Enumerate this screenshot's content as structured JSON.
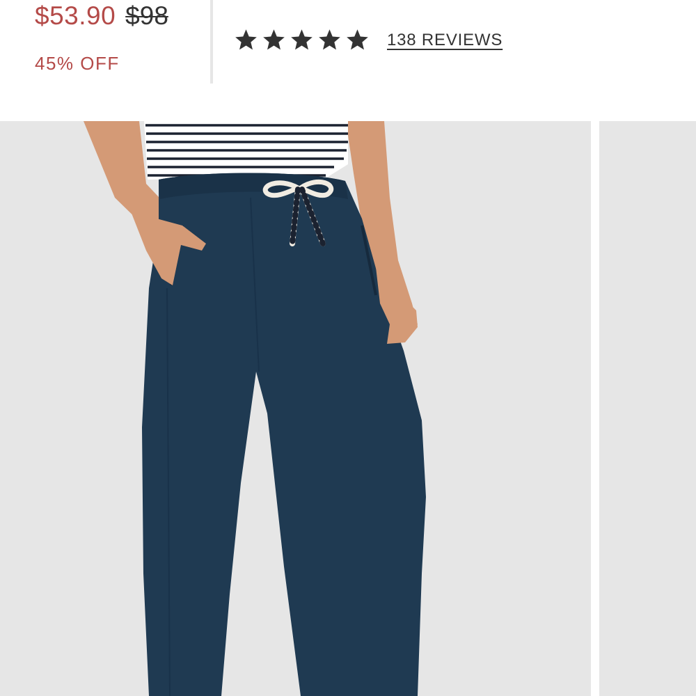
{
  "pricing": {
    "sale_price": "$53.90",
    "original_price": "$98",
    "discount": "45% OFF"
  },
  "rating": {
    "stars": 5,
    "max_stars": 5,
    "reviews_label": "138 REVIEWS"
  },
  "colors": {
    "accent": "#b44a48",
    "star": "#333333",
    "photo_background": "#e6e6e6",
    "product": "#1f3a52"
  }
}
